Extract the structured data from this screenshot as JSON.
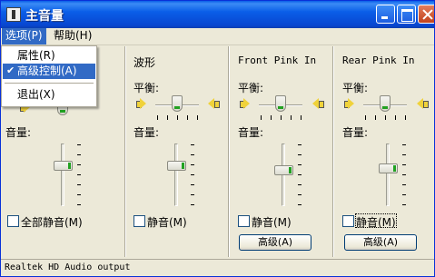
{
  "window": {
    "title": "主音量"
  },
  "menu": {
    "options": "选项(P)",
    "help": "帮助(H)"
  },
  "dropdown": {
    "properties": "属性(R)",
    "advanced": "高级控制(A)",
    "exit": "退出(X)"
  },
  "columns": [
    {
      "title": "",
      "balance": "",
      "volume": "音量:",
      "mute": "全部静音(M)",
      "advanced": ""
    },
    {
      "title": "波形",
      "balance": "平衡:",
      "volume": "音量:",
      "mute": "静音(M)",
      "advanced": ""
    },
    {
      "title": "Front Pink In",
      "balance": "平衡:",
      "volume": "音量:",
      "mute": "静音(M)",
      "advanced": "高级(A)"
    },
    {
      "title": "Rear Pink In",
      "balance": "平衡:",
      "volume": "音量:",
      "mute": "静音(M)",
      "advanced": "高级(A)"
    }
  ],
  "status": {
    "text": "Realtek HD Audio output"
  },
  "icons": {
    "app": "volume-control-icon",
    "speaker": "speaker-icon",
    "check": "check-icon"
  },
  "colors": {
    "title_bar": "#0a5ee8",
    "highlight": "#316ac5",
    "slider_indicator": "#21a121"
  }
}
